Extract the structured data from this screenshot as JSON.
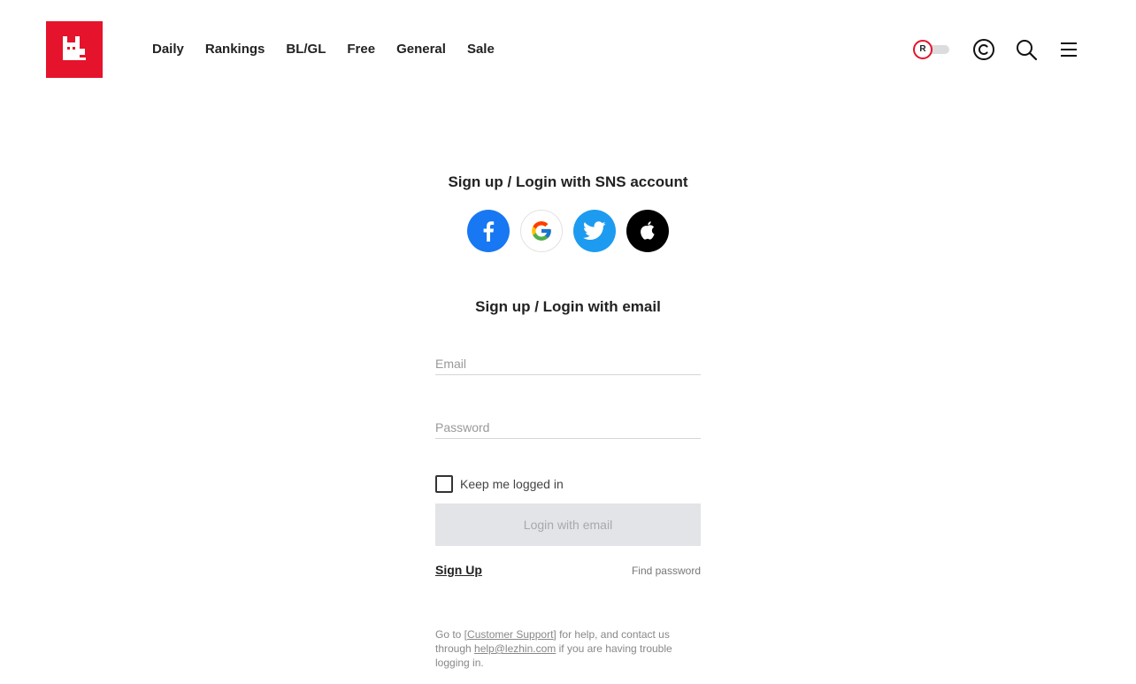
{
  "header": {
    "logo_icon": "lezhin-cat-logo-icon",
    "brand_color": "#e5132b",
    "nav": [
      {
        "label": "Daily"
      },
      {
        "label": "Rankings"
      },
      {
        "label": "BL/GL"
      },
      {
        "label": "Free"
      },
      {
        "label": "General"
      },
      {
        "label": "Sale"
      }
    ],
    "adult_toggle": {
      "badge": "R",
      "on": false
    },
    "icons": [
      "coin-icon",
      "search-icon",
      "menu-icon"
    ]
  },
  "login": {
    "sns_title": "Sign up / Login with SNS account",
    "sns_buttons": [
      {
        "icon": "facebook-icon",
        "color": "#1877f2"
      },
      {
        "icon": "google-icon",
        "color": "#ffffff"
      },
      {
        "icon": "twitter-icon",
        "color": "#1d9bf0"
      },
      {
        "icon": "apple-icon",
        "color": "#000000"
      }
    ],
    "email_title": "Sign up / Login with email",
    "email_placeholder": "Email",
    "email_value": "",
    "password_placeholder": "Password",
    "password_value": "",
    "keep_logged_in": "Keep me logged in",
    "keep_checked": false,
    "login_button": "Login with email",
    "signup_link": "Sign Up",
    "find_password": "Find password",
    "help": {
      "prefix": "Go to [",
      "support_link": "Customer Support",
      "middle": "] for help, and contact us through ",
      "email_link": "help@lezhin.com",
      "suffix": " if you are having trouble logging in."
    }
  }
}
